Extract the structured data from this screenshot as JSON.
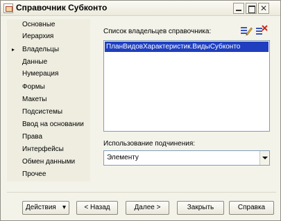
{
  "window": {
    "title": "Справочник Субконто"
  },
  "sidebar": {
    "items": [
      {
        "label": "Основные",
        "selected": false
      },
      {
        "label": "Иерархия",
        "selected": false
      },
      {
        "label": "Владельцы",
        "selected": true
      },
      {
        "label": "Данные",
        "selected": false
      },
      {
        "label": "Нумерация",
        "selected": false
      },
      {
        "label": "Формы",
        "selected": false
      },
      {
        "label": "Макеты",
        "selected": false
      },
      {
        "label": "Подсистемы",
        "selected": false
      },
      {
        "label": "Ввод на основании",
        "selected": false
      },
      {
        "label": "Права",
        "selected": false
      },
      {
        "label": "Интерфейсы",
        "selected": false
      },
      {
        "label": "Обмен данными",
        "selected": false
      },
      {
        "label": "Прочее",
        "selected": false
      }
    ],
    "selected_marker": "▸"
  },
  "owners": {
    "list_label": "Список владельцев справочника:",
    "items": [
      "ПланВидовХарактеристик.ВидыСубконто"
    ],
    "tool_icons": [
      "edit-list-icon",
      "delete-list-icon"
    ]
  },
  "subordination": {
    "label": "Использование подчинения:",
    "value": "Элементу"
  },
  "buttons": {
    "actions": "Действия",
    "actions_arrow": "▾",
    "back": "< Назад",
    "next": "Далее >",
    "close": "Закрыть",
    "help": "Справка"
  }
}
